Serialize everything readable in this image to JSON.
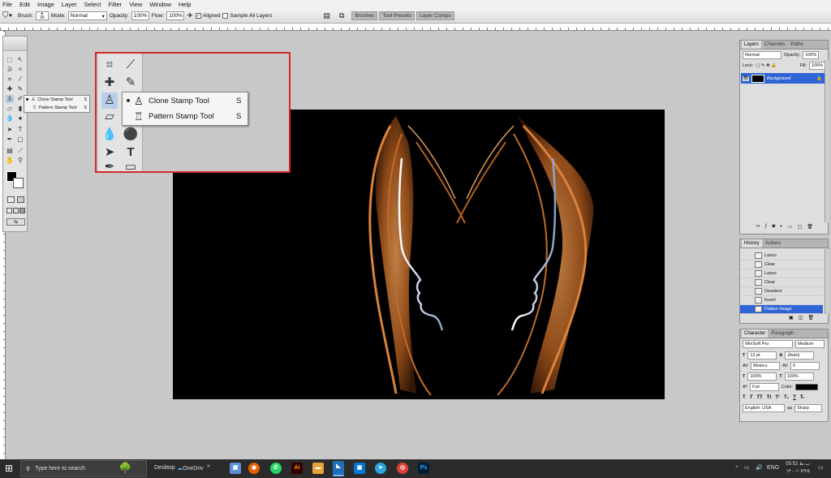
{
  "menubar": [
    "File",
    "Edit",
    "Image",
    "Layer",
    "Select",
    "Filter",
    "View",
    "Window",
    "Help"
  ],
  "options_bar": {
    "brush_label": "Brush:",
    "brush_size": "30",
    "mode_label": "Mode:",
    "mode_value": "Normal",
    "opacity_label": "Opacity:",
    "opacity_value": "100%",
    "flow_label": "Flow:",
    "flow_value": "100%",
    "aligned_label": "Aligned",
    "sample_all_label": "Sample All Layers",
    "panel_tabs": [
      "Brushes",
      "Tool Presets",
      "Layer Comps"
    ]
  },
  "flyout_small": {
    "items": [
      {
        "label": "Clone Stamp Tool",
        "key": "S"
      },
      {
        "label": "Pattern Stamp Tool",
        "key": "S"
      }
    ]
  },
  "flyout_zoom": {
    "items": [
      {
        "label": "Clone Stamp Tool",
        "key": "S"
      },
      {
        "label": "Pattern Stamp Tool",
        "key": "S"
      }
    ]
  },
  "layers_panel": {
    "tabs": [
      "Layers",
      "Channels",
      "Paths"
    ],
    "blend_mode": "Normal",
    "opacity_label": "Opacity:",
    "opacity_value": "100%",
    "lock_label": "Lock:",
    "fill_label": "Fill:",
    "fill_value": "100%",
    "layer_name": "Background"
  },
  "history_panel": {
    "tabs": [
      "History",
      "Actions"
    ],
    "steps": [
      "Lasso",
      "Clear",
      "Lasso",
      "Clear",
      "Deselect",
      "Invert",
      "Flatten Image"
    ]
  },
  "character_panel": {
    "tabs": [
      "Character",
      "Paragraph"
    ],
    "font_family": "WinSoft Pro",
    "font_style": "Medium",
    "font_size": "12 pt",
    "leading": "(Auto)",
    "kerning": "Metrics",
    "tracking": "0",
    "vertical_scale": "100%",
    "horizontal_scale": "100%",
    "baseline_shift": "0 pt",
    "color_label": "Color:",
    "style_buttons": [
      "T",
      "T",
      "TT",
      "Tt",
      "T¹",
      "T₁",
      "T",
      "T̶"
    ],
    "language": "English: USA",
    "antialias": "Sharp"
  },
  "taskbar": {
    "search_placeholder": "Type here to search",
    "desktop_label": "Desktop",
    "onedrive_label": "OneDriv",
    "language": "ENG",
    "time": "05:52 ب.ظ",
    "date": "۱۴۰۰/۰۷/۲۵"
  },
  "colors": {
    "highlight_border": "#d42828",
    "selected_layer": "#2f64d6",
    "taskbar": "#2b2b2b"
  }
}
